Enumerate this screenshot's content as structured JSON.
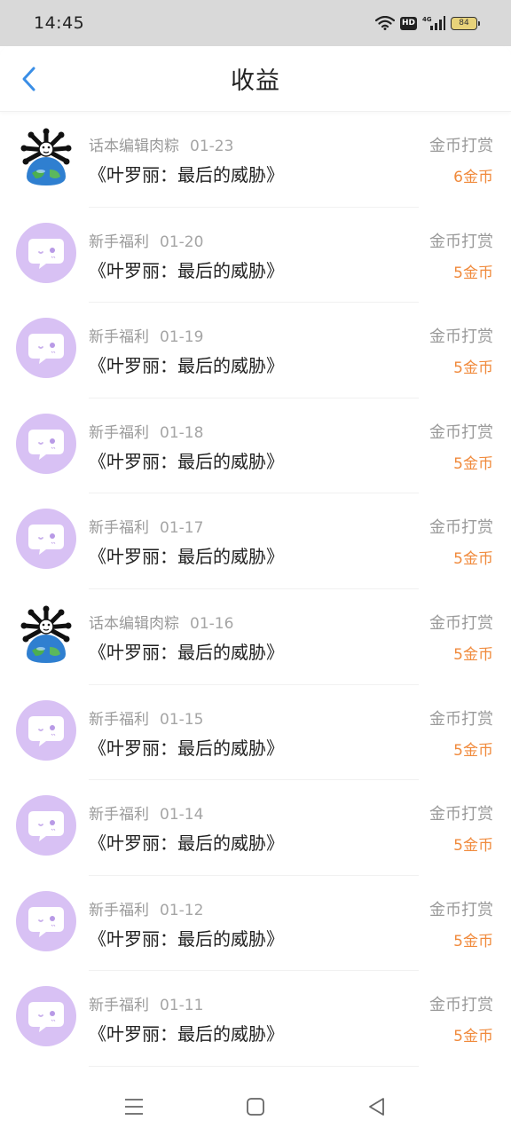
{
  "status_bar": {
    "time": "14:45",
    "hd": "HD",
    "network": "4G",
    "battery": "84"
  },
  "header": {
    "title": "收益",
    "accent_color": "#3a8ee6"
  },
  "records": [
    {
      "source": "话本编辑肉粽",
      "date": "01-23",
      "book": "《叶罗丽：最后的威胁》",
      "type": "金币打赏",
      "amount": "6金币",
      "avatar": "globe"
    },
    {
      "source": "新手福利",
      "date": "01-20",
      "book": "《叶罗丽：最后的威胁》",
      "type": "金币打赏",
      "amount": "5金币",
      "avatar": "chat-bubble"
    },
    {
      "source": "新手福利",
      "date": "01-19",
      "book": "《叶罗丽：最后的威胁》",
      "type": "金币打赏",
      "amount": "5金币",
      "avatar": "chat-bubble"
    },
    {
      "source": "新手福利",
      "date": "01-18",
      "book": "《叶罗丽：最后的威胁》",
      "type": "金币打赏",
      "amount": "5金币",
      "avatar": "chat-bubble"
    },
    {
      "source": "新手福利",
      "date": "01-17",
      "book": "《叶罗丽：最后的威胁》",
      "type": "金币打赏",
      "amount": "5金币",
      "avatar": "chat-bubble"
    },
    {
      "source": "话本编辑肉粽",
      "date": "01-16",
      "book": "《叶罗丽：最后的威胁》",
      "type": "金币打赏",
      "amount": "5金币",
      "avatar": "globe"
    },
    {
      "source": "新手福利",
      "date": "01-15",
      "book": "《叶罗丽：最后的威胁》",
      "type": "金币打赏",
      "amount": "5金币",
      "avatar": "chat-bubble"
    },
    {
      "source": "新手福利",
      "date": "01-14",
      "book": "《叶罗丽：最后的威胁》",
      "type": "金币打赏",
      "amount": "5金币",
      "avatar": "chat-bubble"
    },
    {
      "source": "新手福利",
      "date": "01-12",
      "book": "《叶罗丽：最后的威胁》",
      "type": "金币打赏",
      "amount": "5金币",
      "avatar": "chat-bubble"
    },
    {
      "source": "新手福利",
      "date": "01-11",
      "book": "《叶罗丽：最后的威胁》",
      "type": "金币打赏",
      "amount": "5金币",
      "avatar": "chat-bubble"
    }
  ],
  "colors": {
    "amount": "#f08a3c",
    "avatar_purple": "#d8c1f4"
  },
  "system_nav": [
    "menu-icon",
    "home-icon",
    "back-triangle-icon"
  ]
}
